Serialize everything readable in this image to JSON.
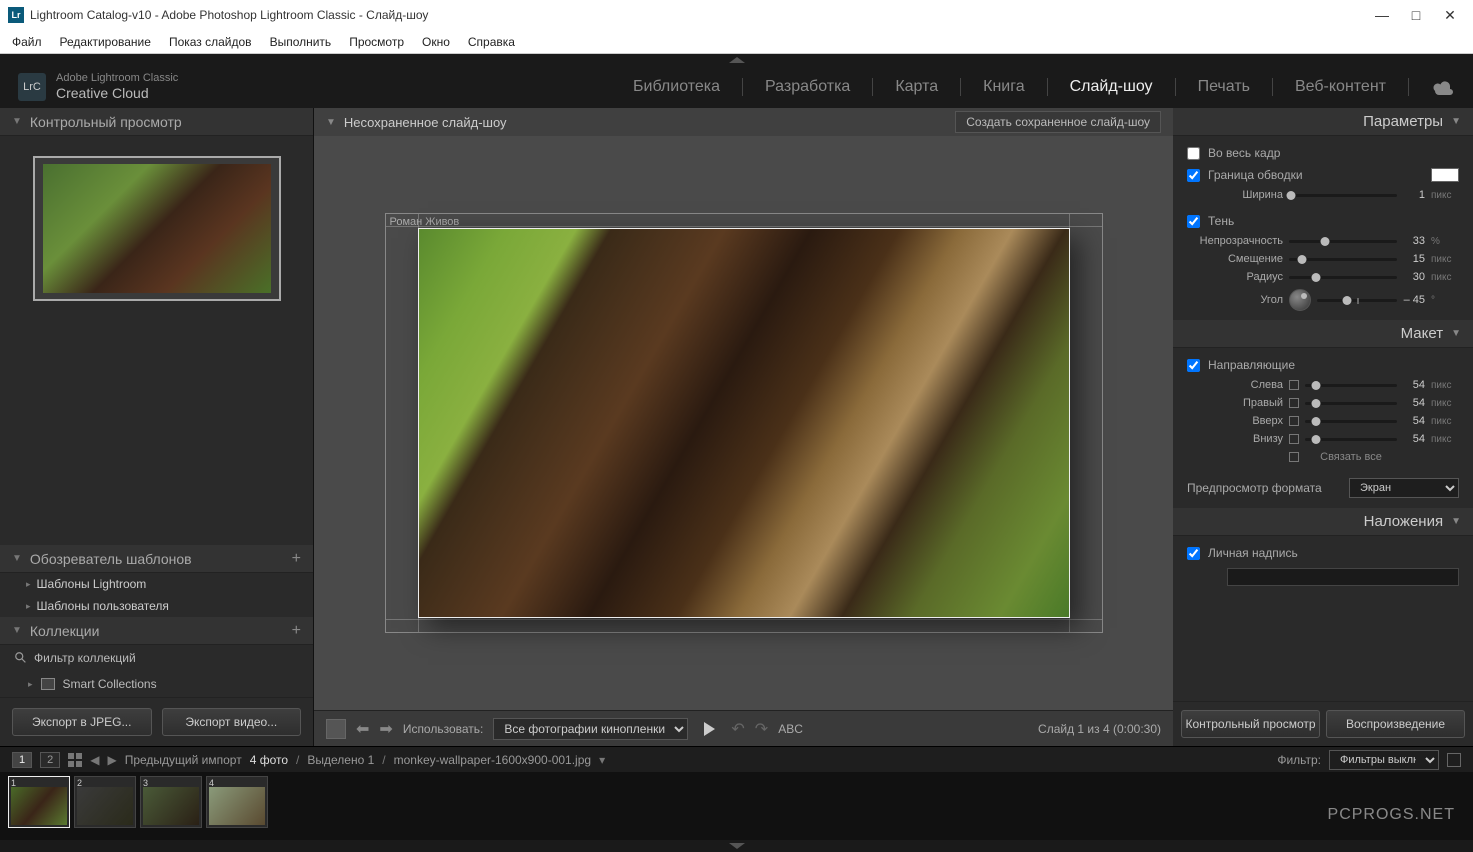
{
  "window": {
    "title": "Lightroom Catalog-v10 - Adobe Photoshop Lightroom Classic - Слайд-шоу"
  },
  "menu": {
    "items": [
      "Файл",
      "Редактирование",
      "Показ слайдов",
      "Выполнить",
      "Просмотр",
      "Окно",
      "Справка"
    ]
  },
  "brand": {
    "product": "Adobe Lightroom Classic",
    "suite": "Creative Cloud",
    "logo": "LrC"
  },
  "modules": {
    "items": [
      "Библиотека",
      "Разработка",
      "Карта",
      "Книга",
      "Слайд-шоу",
      "Печать",
      "Веб-контент"
    ],
    "active": "Слайд-шоу"
  },
  "left": {
    "preview_header": "Контрольный просмотр",
    "templates_header": "Обозреватель шаблонов",
    "template_items": [
      "Шаблоны Lightroom",
      "Шаблоны пользователя"
    ],
    "collections_header": "Коллекции",
    "filter_placeholder": "Фильтр коллекций",
    "smart": "Smart Collections",
    "export_jpeg": "Экспорт в JPEG...",
    "export_video": "Экспорт видео..."
  },
  "center": {
    "header": "Несохраненное слайд-шоу",
    "save_btn": "Создать сохраненное слайд-шоу",
    "caption": "Роман Живов",
    "use_label": "Использовать:",
    "use_value": "Все фотографии кинопленки",
    "abc": "ABC",
    "counter": "Слайд 1 из 4 (0:00:30)"
  },
  "right": {
    "parameters": "Параметры",
    "full_frame": "Во весь кадр",
    "stroke": "Граница обводки",
    "width_label": "Ширина",
    "width_val": "1",
    "px": "пикс",
    "shadow": "Тень",
    "opacity_label": "Непрозрачность",
    "opacity_val": "33",
    "pct": "%",
    "offset_label": "Смещение",
    "offset_val": "15",
    "radius_label": "Радиус",
    "radius_val": "30",
    "angle_label": "Угол",
    "angle_val": "– 45",
    "deg": "°",
    "layout": "Макет",
    "guides": "Направляющие",
    "left_label": "Слева",
    "right_label": "Правый",
    "top_label": "Вверх",
    "bottom_label": "Внизу",
    "margin_val": "54",
    "link_all": "Связать все",
    "preview_fmt": "Предпросмотр формата",
    "preview_val": "Экран",
    "overlays": "Наложения",
    "identity": "Личная надпись",
    "preview_btn": "Контрольный просмотр",
    "play_btn": "Воспроизведение"
  },
  "bottom": {
    "prev_import": "Предыдущий импорт",
    "count": "4 фото",
    "selected": "Выделено 1",
    "filename": "monkey-wallpaper-1600x900-001.jpg",
    "filter_label": "Фильтр:",
    "filter_val": "Фильтры выключ..."
  },
  "filmstrip": {
    "thumbs": [
      "1",
      "2",
      "3",
      "4"
    ]
  },
  "watermark": "PCPROGS.NET"
}
